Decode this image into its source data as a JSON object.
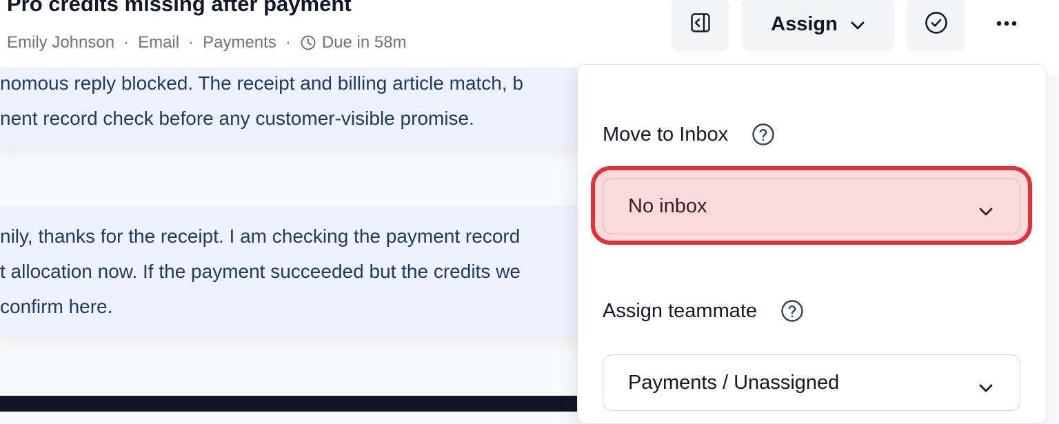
{
  "header": {
    "title": "Pro credits missing after payment",
    "meta": {
      "customer": "Emily Johnson",
      "channel": "Email",
      "category": "Payments",
      "due": "Due in 58m"
    },
    "buttons": {
      "assign_label": "Assign"
    },
    "icons": {
      "panel": "panel-toggle-icon",
      "assign_chevron": "chevron-down-icon",
      "resolve": "check-circle-icon",
      "more": "more-horizontal-icon",
      "clock": "clock-icon"
    }
  },
  "notes": [
    {
      "lines": [
        "nomous reply blocked. The receipt and billing article match, b",
        "nent record check before any customer-visible promise."
      ]
    },
    {
      "lines": [
        "nily, thanks for the receipt. I am checking the payment record",
        "t allocation now. If the payment succeeded but the credits we",
        "confirm here."
      ]
    }
  ],
  "dropdown": {
    "inbox": {
      "label": "Move to Inbox",
      "value": "No inbox"
    },
    "teammate": {
      "label": "Assign teammate",
      "value": "Payments / Unassigned"
    }
  },
  "colors": {
    "note_bg": "#eef2fe",
    "note_text": "#1e3a5f",
    "highlight": "#e5303a",
    "dark_bar": "#121527"
  }
}
